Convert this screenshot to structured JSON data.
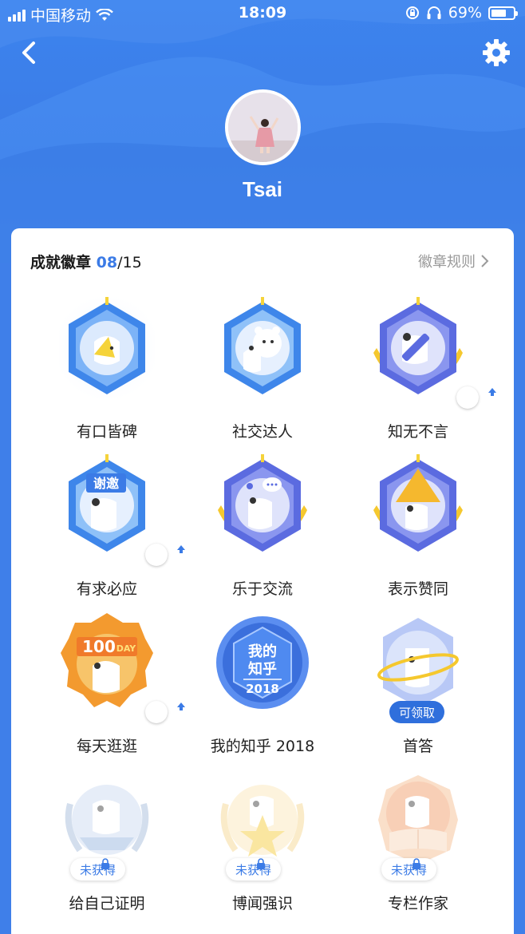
{
  "status_bar": {
    "carrier": "中国移动",
    "time": "18:09",
    "battery": "69%",
    "battery_level": 0.69
  },
  "header": {
    "back_icon": "chevron-left-icon",
    "settings_icon": "gear-icon",
    "username": "Tsai"
  },
  "achievements": {
    "title": "成就徽章",
    "earned": "08",
    "total": "/15",
    "rules_label": "徽章规则",
    "badges": [
      {
        "label": "有口皆碑",
        "state": "earned",
        "icon": "megaphone-badge-icon"
      },
      {
        "label": "社交达人",
        "state": "earned",
        "icon": "bear-friends-badge-icon"
      },
      {
        "label": "知无不言",
        "state": "earned-upgradable",
        "icon": "pencil-badge-icon"
      },
      {
        "label": "有求必应",
        "state": "earned-upgradable",
        "icon": "thanks-sign-badge-icon",
        "sign_text": "谢邀"
      },
      {
        "label": "乐于交流",
        "state": "earned",
        "icon": "chat-bubble-badge-icon"
      },
      {
        "label": "表示赞同",
        "state": "earned",
        "icon": "upvote-badge-icon"
      },
      {
        "label": "每天逛逛",
        "state": "earned-upgradable",
        "icon": "100-day-badge-icon",
        "banner_text": "100",
        "banner_sub": "DAY"
      },
      {
        "label": "我的知乎 2018",
        "state": "earned",
        "icon": "yearly-2018-badge-icon",
        "line1": "我的",
        "line2": "知乎",
        "year": "2018"
      },
      {
        "label": "首答",
        "state": "claimable",
        "icon": "first-answer-badge-icon",
        "pill": "可领取"
      },
      {
        "label": "给自己证明",
        "state": "locked",
        "icon": "proof-badge-icon",
        "pill": "未获得"
      },
      {
        "label": "博闻强识",
        "state": "locked",
        "icon": "star-badge-icon",
        "pill": "未获得"
      },
      {
        "label": "专栏作家",
        "state": "locked",
        "icon": "columnist-badge-icon",
        "pill": "未获得"
      }
    ]
  },
  "colors": {
    "brand_blue": "#3b7be6",
    "header_blue": "#3d84ee",
    "text_dark": "#222222",
    "text_muted": "#9a9a9a"
  }
}
